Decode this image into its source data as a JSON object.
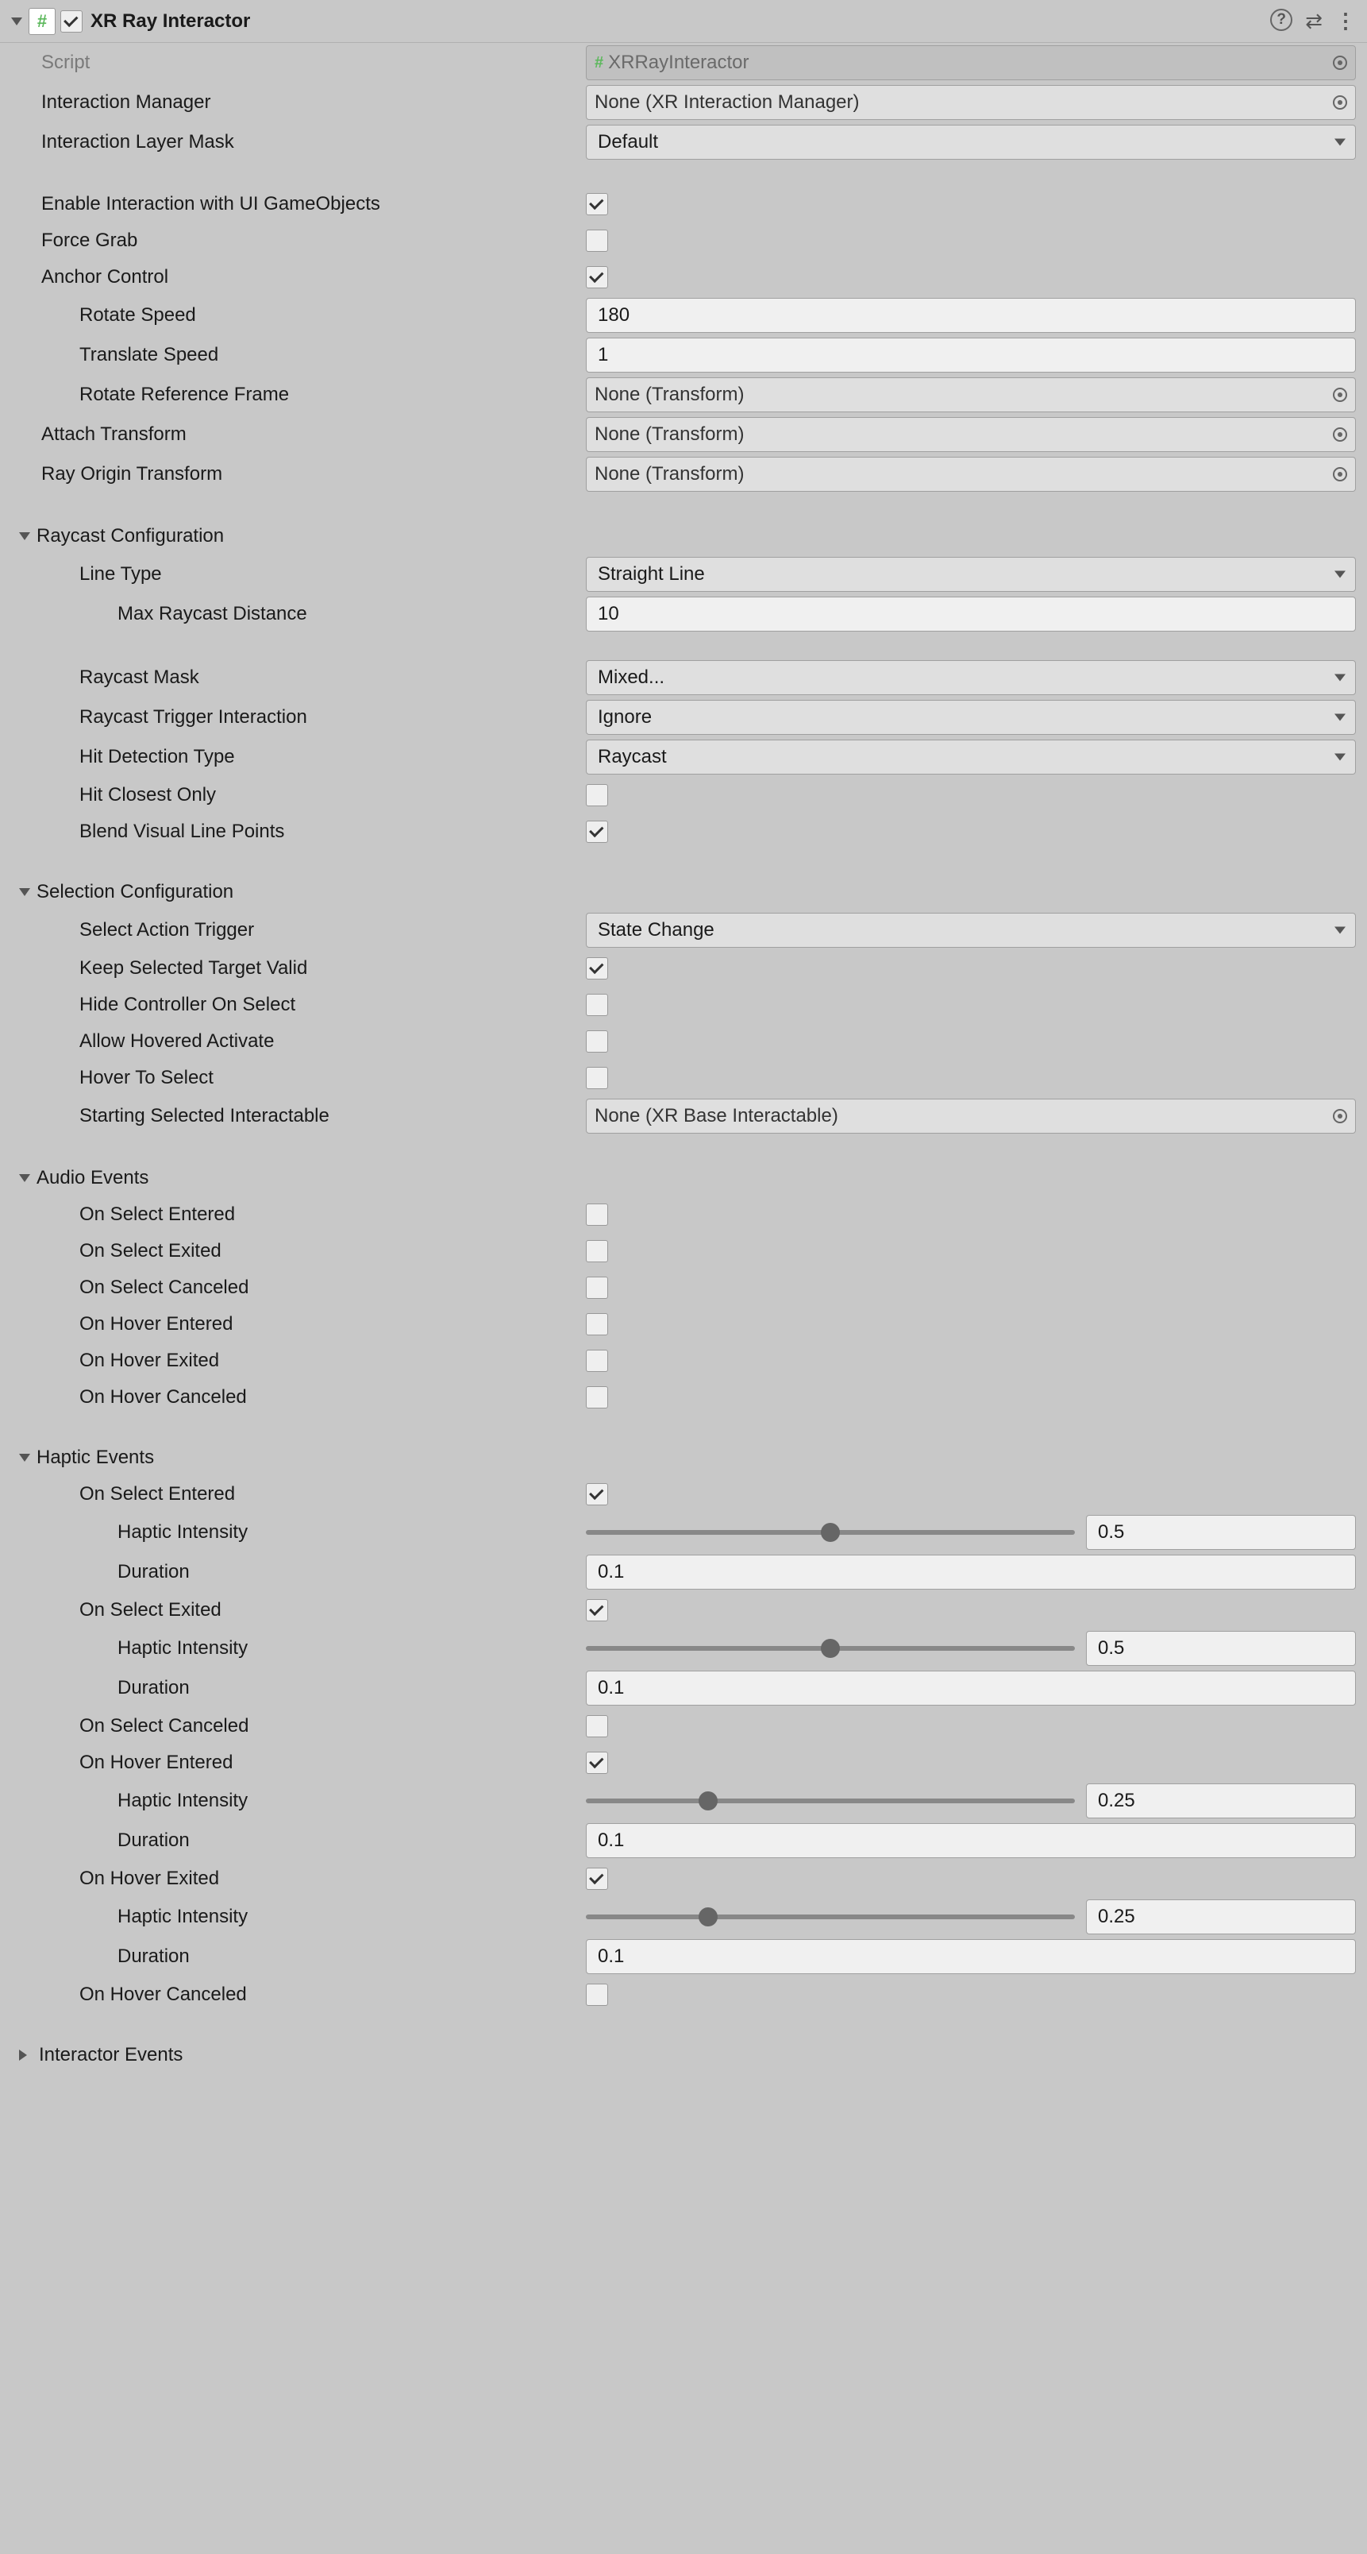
{
  "header": {
    "title": "XR Ray Interactor",
    "help_icon": "?",
    "preset_icon": "⇄",
    "menu_icon": "⋮"
  },
  "fields": {
    "script_label": "Script",
    "script_value": "XRRayInteractor",
    "interaction_manager_label": "Interaction Manager",
    "interaction_manager_value": "None (XR Interaction Manager)",
    "interaction_layer_mask_label": "Interaction Layer Mask",
    "interaction_layer_mask_value": "Default",
    "enable_ui_label": "Enable Interaction with UI GameObjects",
    "force_grab_label": "Force Grab",
    "anchor_control_label": "Anchor Control",
    "rotate_speed_label": "Rotate Speed",
    "rotate_speed_value": "180",
    "translate_speed_label": "Translate Speed",
    "translate_speed_value": "1",
    "rotate_ref_frame_label": "Rotate Reference Frame",
    "rotate_ref_frame_value": "None (Transform)",
    "attach_transform_label": "Attach Transform",
    "attach_transform_value": "None (Transform)",
    "ray_origin_label": "Ray Origin Transform",
    "ray_origin_value": "None (Transform)"
  },
  "raycast": {
    "section": "Raycast Configuration",
    "line_type_label": "Line Type",
    "line_type_value": "Straight Line",
    "max_dist_label": "Max Raycast Distance",
    "max_dist_value": "10",
    "raycast_mask_label": "Raycast Mask",
    "raycast_mask_value": "Mixed...",
    "trigger_label": "Raycast Trigger Interaction",
    "trigger_value": "Ignore",
    "hit_type_label": "Hit Detection Type",
    "hit_type_value": "Raycast",
    "hit_closest_label": "Hit Closest Only",
    "blend_label": "Blend Visual Line Points"
  },
  "selection": {
    "section": "Selection Configuration",
    "action_trigger_label": "Select Action Trigger",
    "action_trigger_value": "State Change",
    "keep_valid_label": "Keep Selected Target Valid",
    "hide_controller_label": "Hide Controller On Select",
    "allow_hover_act_label": "Allow Hovered Activate",
    "hover_to_select_label": "Hover To Select",
    "start_interactable_label": "Starting Selected Interactable",
    "start_interactable_value": "None (XR Base Interactable)"
  },
  "audio": {
    "section": "Audio Events",
    "on_select_entered": "On Select Entered",
    "on_select_exited": "On Select Exited",
    "on_select_canceled": "On Select Canceled",
    "on_hover_entered": "On Hover Entered",
    "on_hover_exited": "On Hover Exited",
    "on_hover_canceled": "On Hover Canceled"
  },
  "haptic": {
    "section": "Haptic Events",
    "intensity_label": "Haptic Intensity",
    "duration_label": "Duration",
    "on_select_entered": "On Select Entered",
    "select_entered_intensity": "0.5",
    "select_entered_duration": "0.1",
    "on_select_exited": "On Select Exited",
    "select_exited_intensity": "0.5",
    "select_exited_duration": "0.1",
    "on_select_canceled": "On Select Canceled",
    "on_hover_entered": "On Hover Entered",
    "hover_entered_intensity": "0.25",
    "hover_entered_duration": "0.1",
    "on_hover_exited": "On Hover Exited",
    "hover_exited_intensity": "0.25",
    "hover_exited_duration": "0.1",
    "on_hover_canceled": "On Hover Canceled"
  },
  "interactor_events_section": "Interactor Events"
}
